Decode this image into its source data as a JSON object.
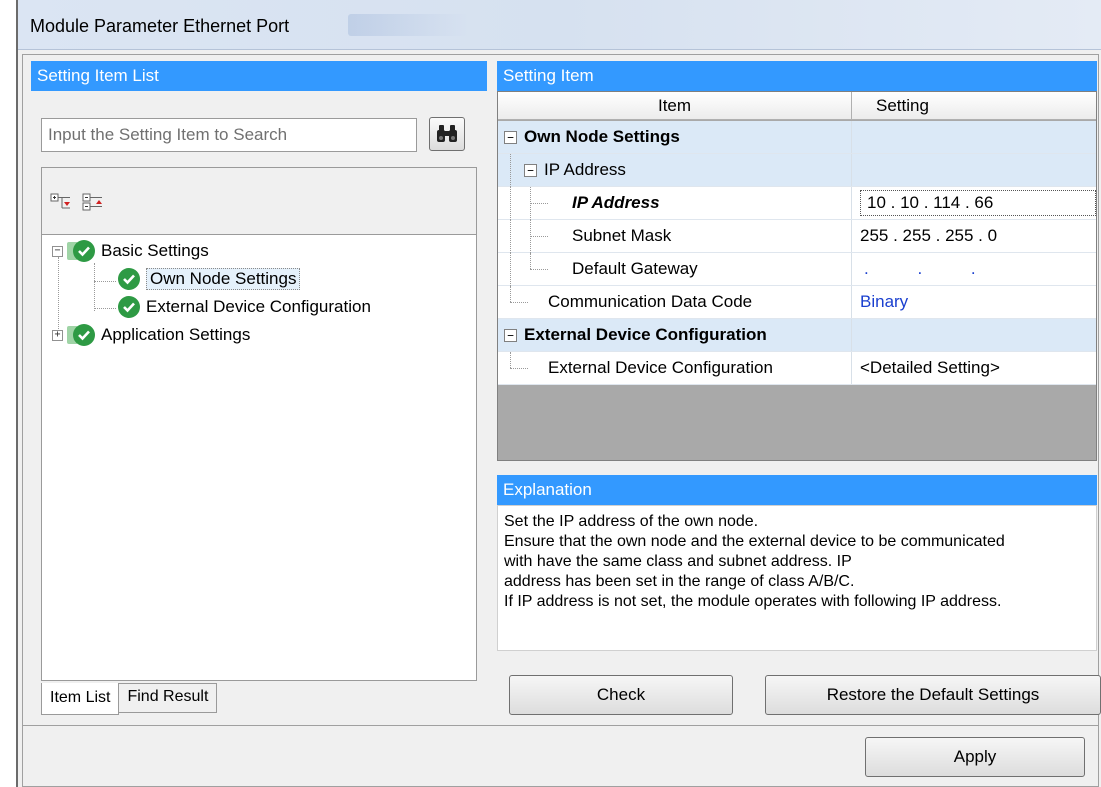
{
  "window": {
    "title": "Module Parameter Ethernet Port"
  },
  "left_pane": {
    "header": "Setting Item List",
    "search_placeholder": "Input the Setting Item to Search",
    "tree": [
      {
        "label": "Basic Settings",
        "expanded": true,
        "status": "check"
      },
      {
        "label": "Own Node Settings",
        "selected": true,
        "status": "check"
      },
      {
        "label": "External Device Configuration",
        "status": "check"
      },
      {
        "label": "Application Settings",
        "expanded": false,
        "status": "check"
      }
    ],
    "tabs": [
      "Item List",
      "Find Result"
    ]
  },
  "grid": {
    "header": "Setting Item",
    "columns": [
      "Item",
      "Setting"
    ],
    "rows": [
      {
        "item": "Own Node Settings",
        "setting": ""
      },
      {
        "item": "IP Address",
        "setting": ""
      },
      {
        "item": "IP Address",
        "setting": "10 . 10 . 114 . 66"
      },
      {
        "item": "Subnet Mask",
        "setting": "255 . 255 . 255 .  0"
      },
      {
        "item": "Default Gateway",
        "setting": ". . ."
      },
      {
        "item": "Communication Data Code",
        "setting": "Binary"
      },
      {
        "item": "External Device Configuration",
        "setting": ""
      },
      {
        "item": "External Device Configuration",
        "setting": "<Detailed Setting>"
      }
    ]
  },
  "explanation": {
    "header": "Explanation",
    "lines": [
      "Set the IP address of the own node.",
      "Ensure that the own node and the external device to be communicated",
      "with have the same class and subnet address. IP",
      "address has been set in the range of class A/B/C.",
      "If IP address is not set, the module operates with following IP address."
    ]
  },
  "buttons": {
    "check": "Check",
    "restore": "Restore the Default Settings",
    "apply": "Apply"
  },
  "colors": {
    "header_blue": "#3399ff",
    "check_green": "#2e9a44",
    "value_blue": "#1a3fcf"
  }
}
